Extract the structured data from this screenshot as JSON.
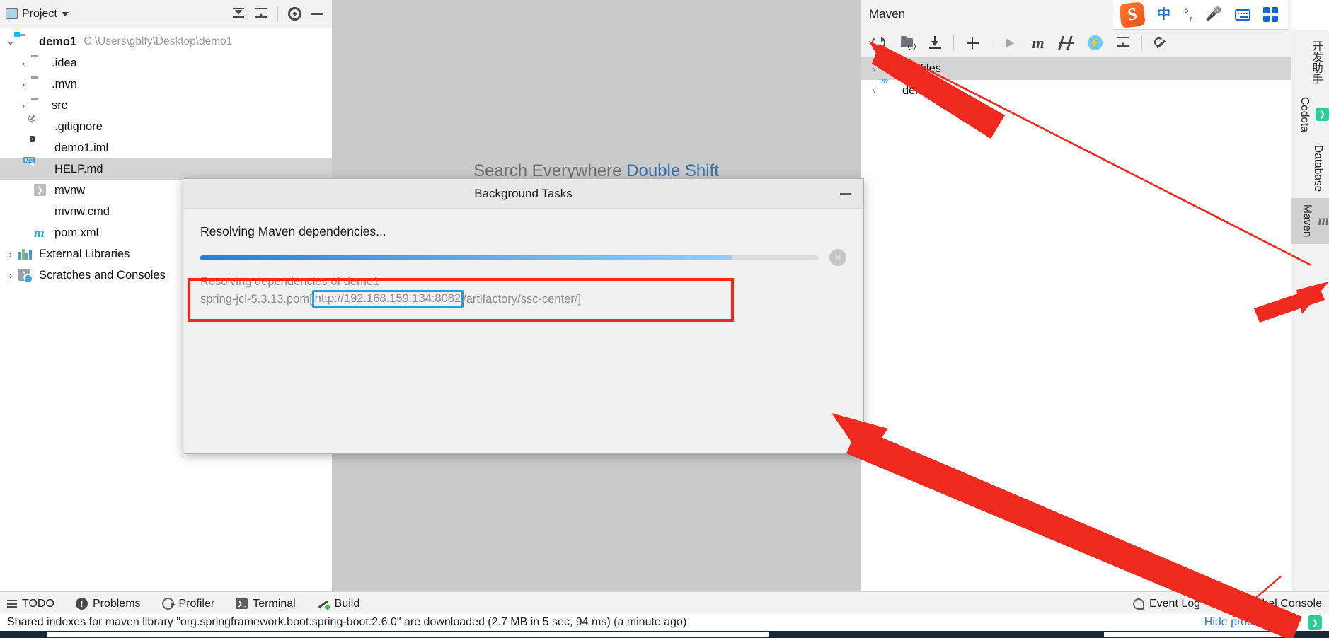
{
  "ime": {
    "logo": "S",
    "items": [
      "中",
      "°,",
      "mic-icon",
      "keyboard-icon",
      "apps-icon"
    ]
  },
  "project_panel": {
    "title": "Project",
    "toolbar": [
      "expand-all-icon",
      "collapse-all-icon",
      "settings-gear-icon",
      "hide-icon"
    ],
    "tree": [
      {
        "label": "demo1",
        "path": "C:\\Users\\gblfy\\Desktop\\demo1",
        "icon": "module-folder-icon",
        "arrow": "expanded",
        "indent": 0,
        "bold": true,
        "selected": false
      },
      {
        "label": ".idea",
        "path": "",
        "icon": "folder-icon",
        "arrow": "collapsed",
        "indent": 1,
        "bold": false,
        "selected": false
      },
      {
        "label": ".mvn",
        "path": "",
        "icon": "folder-icon",
        "arrow": "collapsed",
        "indent": 1,
        "bold": false,
        "selected": false
      },
      {
        "label": "src",
        "path": "",
        "icon": "folder-icon",
        "arrow": "collapsed",
        "indent": 1,
        "bold": false,
        "selected": false
      },
      {
        "label": ".gitignore",
        "path": "",
        "icon": "gitignore-file-icon",
        "arrow": "none",
        "indent": 1,
        "bold": false,
        "selected": false
      },
      {
        "label": "demo1.iml",
        "path": "",
        "icon": "iml-file-icon",
        "arrow": "none",
        "indent": 1,
        "bold": false,
        "selected": false
      },
      {
        "label": "HELP.md",
        "path": "",
        "icon": "markdown-file-icon",
        "arrow": "none",
        "indent": 1,
        "bold": false,
        "selected": true
      },
      {
        "label": "mvnw",
        "path": "",
        "icon": "shell-script-icon",
        "arrow": "none",
        "indent": 1,
        "bold": false,
        "selected": false
      },
      {
        "label": "mvnw.cmd",
        "path": "",
        "icon": "cmd-file-icon",
        "arrow": "none",
        "indent": 1,
        "bold": false,
        "selected": false
      },
      {
        "label": "pom.xml",
        "path": "",
        "icon": "maven-pom-icon",
        "arrow": "none",
        "indent": 1,
        "bold": false,
        "selected": false
      },
      {
        "label": "External Libraries",
        "path": "",
        "icon": "libraries-icon",
        "arrow": "collapsed",
        "indent": 0,
        "bold": false,
        "selected": false
      },
      {
        "label": "Scratches and Consoles",
        "path": "",
        "icon": "scratches-icon",
        "arrow": "collapsed",
        "indent": 0,
        "bold": false,
        "selected": false
      }
    ]
  },
  "editor": {
    "watermark_prefix": "Search Everywhere",
    "watermark_shortcut": "Double Shift"
  },
  "maven_panel": {
    "title": "Maven",
    "toolbar": [
      "reload-all-projects-icon",
      "add-maven-project-icon",
      "download-sources-icon",
      "add-plugin-icon",
      "run-icon",
      "execute-maven-goal-icon",
      "toggle-skip-tests-icon",
      "toggle-offline-icon",
      "collapse-all-icon",
      "maven-settings-icon"
    ],
    "tree": [
      {
        "label": "Profiles",
        "icon": "profiles-icon",
        "arrow": "collapsed",
        "selected": true
      },
      {
        "label": "demo1",
        "icon": "maven-project-icon",
        "arrow": "collapsed",
        "selected": false
      }
    ]
  },
  "right_stripe": {
    "tabs": [
      {
        "label": "开发助手",
        "icon": "assistant-icon",
        "active": false
      },
      {
        "label": "Codota",
        "icon": "codota-icon",
        "active": false
      },
      {
        "label": "Database",
        "icon": "database-icon",
        "active": false
      },
      {
        "label": "Maven",
        "icon": "maven-m-icon",
        "active": true
      }
    ]
  },
  "dialog": {
    "title": "Background Tasks",
    "minimize_label": "minimize-icon",
    "task_name": "Resolving Maven dependencies...",
    "progress_percent": 86,
    "cancel_label": "×",
    "detail_line1": "Resolving dependencies of demo1",
    "detail_prefix": "spring-jcl-5.3.13.pom ",
    "detail_bracket_open": "[",
    "detail_url_host": "http://192.168.159.134:8082",
    "detail_url_path": "/artifactory/ssc-center/",
    "detail_bracket_close": "]",
    "highlight_red": "#ee2a1e",
    "highlight_blue": "#1e9bf0"
  },
  "bottom_tabs": {
    "left": [
      {
        "label": "TODO",
        "icon": "todo-icon"
      },
      {
        "label": "Problems",
        "icon": "problems-icon"
      },
      {
        "label": "Profiler",
        "icon": "profiler-icon"
      },
      {
        "label": "Terminal",
        "icon": "terminal-icon"
      },
      {
        "label": "Build",
        "icon": "build-icon"
      }
    ],
    "right": [
      {
        "label": "Event Log",
        "icon": "event-log-icon"
      },
      {
        "label": "JRebel Console",
        "icon": "jrebel-icon"
      }
    ]
  },
  "status_bar": {
    "message": "Shared indexes for maven library \"org.springframework.boot:spring-boot:2.6.0\" are downloaded (2.7 MB in 5 sec, 94 ms) (a minute ago)",
    "hide_processes": "Hide processes (1)",
    "tray_icon": "terminal-tray-icon"
  },
  "colors": {
    "accent_blue": "#1a7fe0",
    "annotation_red": "#ee2a1e",
    "link_blue": "#2d7ad1",
    "panel_bg": "#f2f2f2",
    "editor_bg": "#c9c9c9"
  }
}
